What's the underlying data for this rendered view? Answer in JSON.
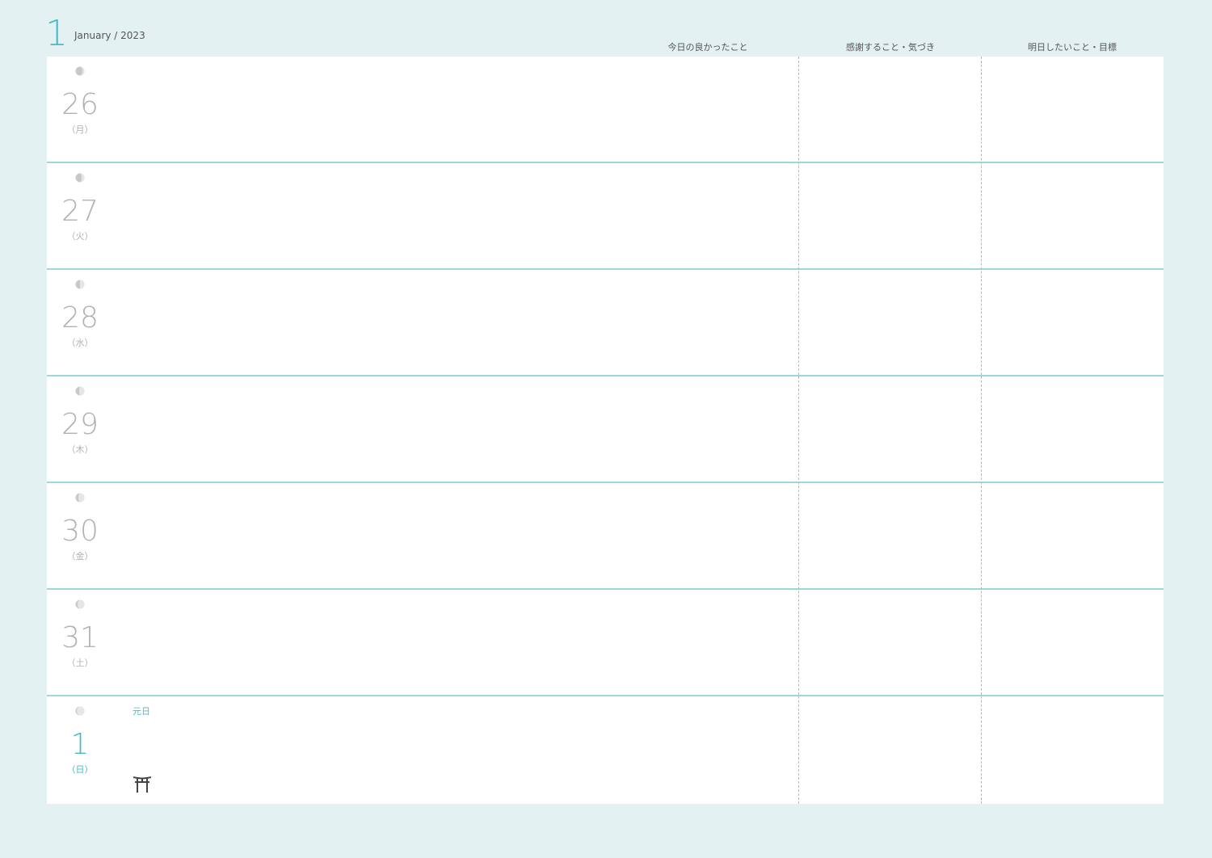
{
  "header": {
    "month_number": "1",
    "month_label": "January / 2023",
    "columns": [
      "今日の良かったこと",
      "感謝すること・気づき",
      "明日したいこと・目標"
    ]
  },
  "days": [
    {
      "day": "26",
      "weekday": "（月）",
      "moon": "waxing-crescent-icon",
      "holiday": ""
    },
    {
      "day": "27",
      "weekday": "（火）",
      "moon": "waxing-crescent-icon",
      "holiday": ""
    },
    {
      "day": "28",
      "weekday": "（水）",
      "moon": "first-quarter-moon-icon",
      "holiday": ""
    },
    {
      "day": "29",
      "weekday": "（木）",
      "moon": "first-quarter-moon-icon",
      "holiday": ""
    },
    {
      "day": "30",
      "weekday": "（金）",
      "moon": "waxing-gibbous-icon",
      "holiday": ""
    },
    {
      "day": "31",
      "weekday": "（土）",
      "moon": "waxing-gibbous-icon",
      "holiday": ""
    },
    {
      "day": "1",
      "weekday": "（日）",
      "moon": "waxing-gibbous-icon",
      "holiday": "元日",
      "icon": "torii-gate-icon"
    }
  ],
  "colors": {
    "background": "#e3f1f2",
    "accent": "#4bbcc6",
    "row_border": "#9fd7de",
    "day_text": "#b2b2b2"
  }
}
